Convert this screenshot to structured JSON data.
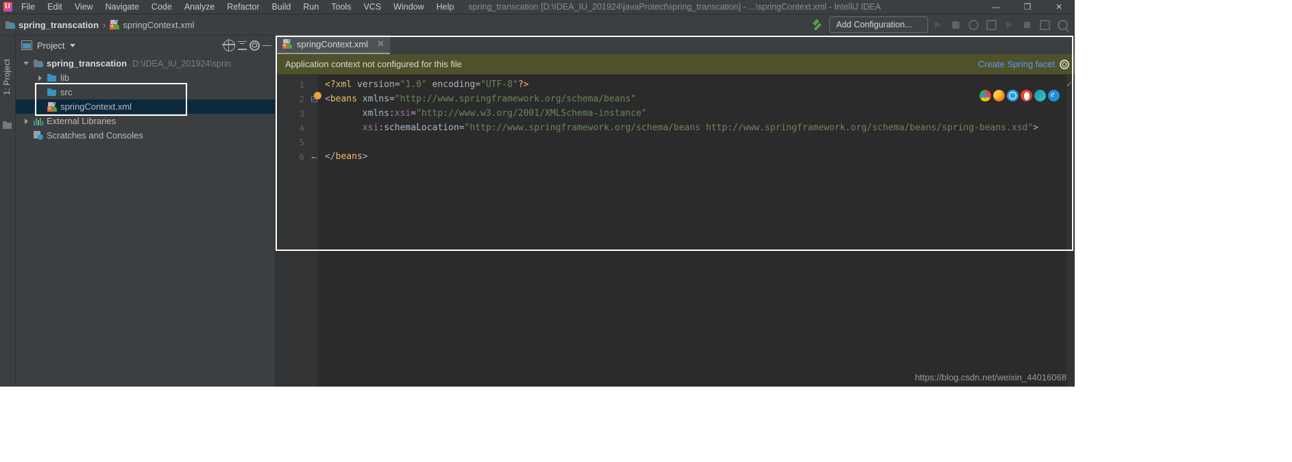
{
  "window": {
    "title": "spring_transcation [D:\\IDEA_IU_201924\\javaProtect\\spring_transcation] - ...\\springContext.xml - IntelliJ IDEA",
    "minimize": "—",
    "maximize": "❐",
    "close": "✕",
    "logo_text": "IJ"
  },
  "menu": {
    "items": [
      "File",
      "Edit",
      "View",
      "Navigate",
      "Code",
      "Analyze",
      "Refactor",
      "Build",
      "Run",
      "Tools",
      "VCS",
      "Window",
      "Help"
    ]
  },
  "navbar": {
    "breadcrumb": [
      {
        "label": "spring_transcation",
        "icon": "module-folder-icon"
      },
      {
        "label": "springContext.xml",
        "icon": "xml-spring-file-icon"
      }
    ],
    "separator": "›",
    "add_configuration": "Add Configuration...",
    "hammer_icon": "build-hammer-icon",
    "toolbar_icons": [
      "run-icon",
      "debug-icon",
      "run-with-coverage-icon",
      "profile-icon",
      "run-alt-icon",
      "stop-icon",
      "update-icon",
      "search-everywhere-icon"
    ]
  },
  "leftstrip": {
    "tab_label": "1: Project",
    "tab_mnemonic": "1"
  },
  "project_panel": {
    "title": "Project",
    "window_icon": "project-window-icon",
    "dropdown_caret": "▼",
    "tools": [
      "locate-target-icon",
      "collapse-all-icon",
      "settings-gear-icon",
      "hide-minus-icon"
    ],
    "tree": [
      {
        "label": "spring_transcation",
        "path": "D:\\IDEA_IU_201924\\sprin",
        "icon": "module-folder-icon",
        "arrow": "open",
        "indent": 0,
        "bold": true,
        "selected": false
      },
      {
        "label": "lib",
        "path": "",
        "icon": "folder-icon",
        "arrow": "closed",
        "indent": 1,
        "bold": false,
        "selected": false
      },
      {
        "label": "src",
        "path": "",
        "icon": "folder-icon",
        "arrow": "none",
        "indent": 1,
        "bold": false,
        "selected": false
      },
      {
        "label": "springContext.xml",
        "path": "",
        "icon": "xml-spring-file-icon",
        "arrow": "none",
        "indent": 1,
        "bold": false,
        "selected": true
      },
      {
        "label": "External Libraries",
        "path": "",
        "icon": "library-icon",
        "arrow": "closed",
        "indent": 0,
        "bold": false,
        "selected": false
      },
      {
        "label": "Scratches and Consoles",
        "path": "",
        "icon": "scratches-icon",
        "arrow": "none",
        "indent": 0,
        "bold": false,
        "selected": false
      }
    ]
  },
  "editor": {
    "tab": {
      "label": "springContext.xml",
      "close": "✕",
      "icon": "xml-spring-file-icon"
    },
    "notification": {
      "message": "Application context not configured for this file",
      "action_link": "Create Spring facet",
      "gear_icon": "notification-settings-gear-icon"
    },
    "inspection_status": "✓",
    "line_numbers": [
      "1",
      "2",
      "3",
      "4",
      "5",
      "6"
    ],
    "lines": [
      [
        {
          "t": "<?xml ",
          "c": "proc"
        },
        {
          "t": "version",
          "c": "punct"
        },
        {
          "t": "=",
          "c": "punct"
        },
        {
          "t": "\"1.0\"",
          "c": "str"
        },
        {
          "t": " encoding",
          "c": "punct"
        },
        {
          "t": "=",
          "c": "punct"
        },
        {
          "t": "\"UTF-8\"",
          "c": "str"
        },
        {
          "t": "?>",
          "c": "proc"
        }
      ],
      [
        {
          "t": "<",
          "c": "punct"
        },
        {
          "t": "beans",
          "c": "tag"
        },
        {
          "t": " xmlns",
          "c": "punct"
        },
        {
          "t": "=",
          "c": "punct"
        },
        {
          "t": "\"http://www.springframework.org/schema/beans\"",
          "c": "str"
        }
      ],
      [
        {
          "t": "       xmlns:",
          "c": "punct"
        },
        {
          "t": "xsi",
          "c": "attr"
        },
        {
          "t": "=",
          "c": "punct"
        },
        {
          "t": "\"http://www.w3.org/2001/XMLSchema-instance\"",
          "c": "str"
        }
      ],
      [
        {
          "t": "       ",
          "c": "punct"
        },
        {
          "t": "xsi",
          "c": "attr"
        },
        {
          "t": ":schemaLocation",
          "c": "punct"
        },
        {
          "t": "=",
          "c": "punct"
        },
        {
          "t": "\"http://www.springframework.org/schema/beans http://www.springframework.org/schema/beans/spring-beans.xsd\"",
          "c": "str"
        },
        {
          "t": ">",
          "c": "punct"
        }
      ],
      [],
      [
        {
          "t": "</",
          "c": "punct"
        },
        {
          "t": "beans",
          "c": "tag"
        },
        {
          "t": ">",
          "c": "punct"
        }
      ]
    ],
    "browser_icons": [
      "chrome-icon",
      "firefox-icon",
      "safari-icon",
      "opera-icon",
      "edge-icon",
      "ie-icon"
    ]
  },
  "watermark": "https://blog.csdn.net/weixin_44016068",
  "colors": {
    "accent_blue": "#589df6",
    "notification_bg": "#4f512a",
    "selection_bg": "#0d293e",
    "editor_bg": "#2b2b2b",
    "panel_bg": "#3c3f41",
    "string_green": "#6a8759",
    "tag_yellow": "#e8bf6a",
    "attr_purple": "#9876aa",
    "highlight_box": "#ffffff"
  }
}
